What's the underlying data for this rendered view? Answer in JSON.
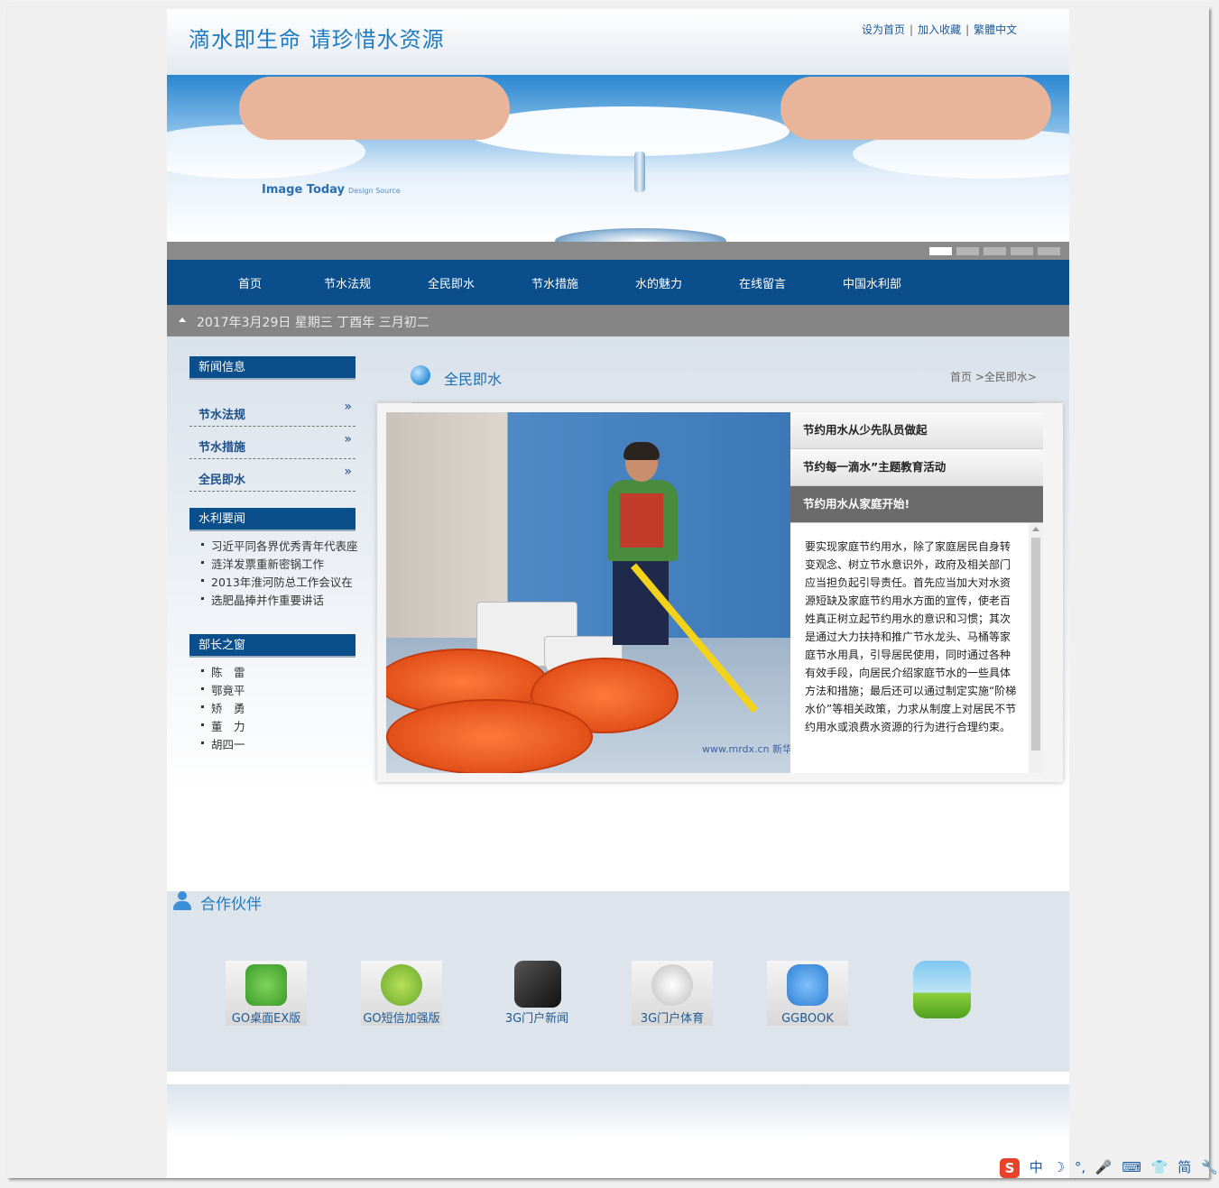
{
  "header": {
    "site_title": "滴水即生命 请珍惜水资源",
    "links": [
      "设为首页",
      "加入收藏",
      "繁體中文"
    ],
    "separator": "|"
  },
  "banner": {
    "brand": "Image Today",
    "brand_sub": "Design Source",
    "slides": 5,
    "active_slide": 1
  },
  "nav": {
    "items": [
      "首页",
      "节水法规",
      "全民即水",
      "节水措施",
      "水的魅力",
      "在线留言",
      "中国水利部"
    ]
  },
  "datebar": {
    "date": "2017年3月29日 星期三 丁酉年 三月初二"
  },
  "sidebar": {
    "news_heading": "新闻信息",
    "news_links": [
      "节水法规",
      "节水措施",
      "全民即水"
    ],
    "chevron": "»",
    "water_heading": "水利要闻",
    "water_items": [
      "习近平同各界优秀青年代表座",
      "涟洋发票重新密锅工作",
      "2013年淮河防总工作会议在",
      "选肥晶捧并作重要讲话"
    ],
    "minister_heading": "部长之窗",
    "minister_items": [
      "陈　雷",
      "鄂竟平",
      "矫　勇",
      "董　力",
      "胡四一"
    ]
  },
  "main": {
    "section_title": "全民即水",
    "breadcrumb": "首页 >全民即水>",
    "photo_watermark": "www.mrdx.cn 新华每日电讯",
    "tabs": [
      "节约用水从少先队员做起",
      "节约每一滴水”主题教育活动",
      "节约用水从家庭开始!"
    ],
    "active_tab": 2,
    "article": "要实现家庭节约用水，除了家庭居民自身转变观念、树立节水意识外，政府及相关部门应当担负起引导责任。首先应当加大对水资源短缺及家庭节约用水方面的宣传，使老百姓真正树立起节约用水的意识和习惯；其次是通过大力扶持和推广节水龙头、马桶等家庭节水用具，引导居民使用，同时通过各种有效手段，向居民介绍家庭节水的一些具体方法和措施；最后还可以通过制定实施“阶梯水价”等相关政策，力求从制度上对居民不节约用水或浪费水资源的行为进行合理约束。"
  },
  "partners": {
    "title": "合作伙伴",
    "logos": [
      {
        "label": "GO桌面EX版",
        "color": "#4caf3a",
        "icon": "clover-icon"
      },
      {
        "label": "GO短信加强版",
        "color": "#8cc63f",
        "icon": "chat-bubble-icon"
      },
      {
        "label": "3G门户新闻",
        "color": "#333333",
        "icon": "3g-news-icon"
      },
      {
        "label": "3G门户体育",
        "color": "#cccccc",
        "icon": "sports-icon"
      },
      {
        "label": "GGBOOK",
        "color": "#2f7fd0",
        "icon": "owl-icon"
      },
      {
        "label": "",
        "color": "#f5c51a",
        "icon": "sun-weather-icon"
      }
    ]
  },
  "ime": {
    "items": [
      "中",
      "☽",
      "°,",
      "🎤",
      "⌨",
      "👕",
      "简",
      "🔧"
    ],
    "logo": "S"
  }
}
